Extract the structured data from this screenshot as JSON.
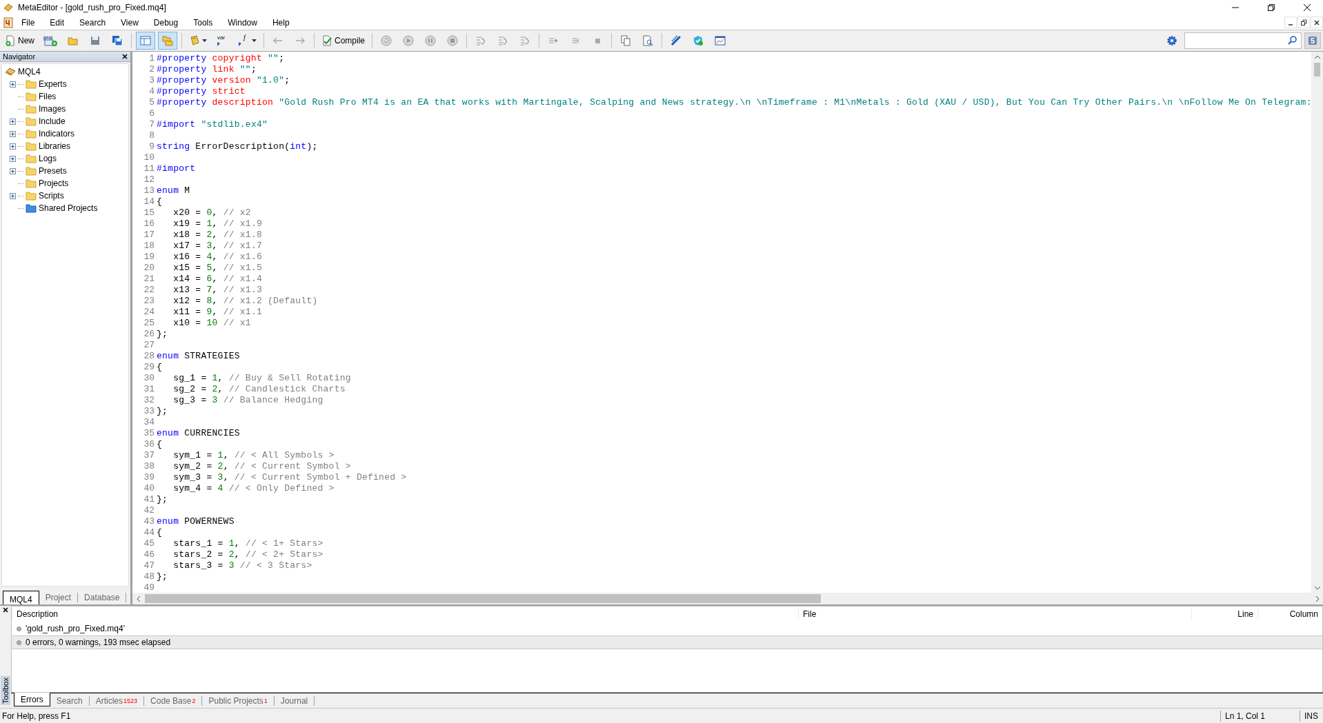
{
  "window": {
    "title": "MetaEditor - [gold_rush_pro_Fixed.mq4]"
  },
  "menu": [
    "File",
    "Edit",
    "Search",
    "View",
    "Debug",
    "Tools",
    "Window",
    "Help"
  ],
  "toolbar": {
    "new_label": "New",
    "project_icon_text": "proj",
    "var_icon_text": "var",
    "function_icon_text": "f",
    "compile_label": "Compile",
    "toggles": [
      {
        "selected": true
      },
      {
        "selected": true
      }
    ],
    "history_disabled": true,
    "debug_disabled": true,
    "messages_count": "5"
  },
  "navigator": {
    "title": "Navigator",
    "root": "MQL4",
    "items": [
      {
        "label": "Experts",
        "kind": "folder",
        "expandable": true
      },
      {
        "label": "Files",
        "kind": "folder",
        "expandable": false
      },
      {
        "label": "Images",
        "kind": "folder",
        "expandable": false
      },
      {
        "label": "Include",
        "kind": "folder",
        "expandable": true
      },
      {
        "label": "Indicators",
        "kind": "folder",
        "expandable": true
      },
      {
        "label": "Libraries",
        "kind": "folder",
        "expandable": true
      },
      {
        "label": "Logs",
        "kind": "folder",
        "expandable": true
      },
      {
        "label": "Presets",
        "kind": "folder",
        "expandable": true
      },
      {
        "label": "Projects",
        "kind": "folder",
        "expandable": false
      },
      {
        "label": "Scripts",
        "kind": "folder",
        "expandable": true
      },
      {
        "label": "Shared Projects",
        "kind": "shared",
        "expandable": false
      }
    ],
    "tabs": [
      {
        "label": "MQL4",
        "selected": true
      },
      {
        "label": "Project",
        "selected": false
      },
      {
        "label": "Database",
        "selected": false
      }
    ]
  },
  "editor": {
    "lines": [
      {
        "n": "1",
        "code": [
          {
            "kind": "directive",
            "text": "#property "
          },
          {
            "kind": "property",
            "text": "copyright "
          },
          {
            "kind": "string",
            "text": "\"\""
          },
          {
            "kind": "plain",
            "text": ";"
          }
        ]
      },
      {
        "n": "2",
        "code": [
          {
            "kind": "directive",
            "text": "#property "
          },
          {
            "kind": "property",
            "text": "link "
          },
          {
            "kind": "string",
            "text": "\"\""
          },
          {
            "kind": "plain",
            "text": ";"
          }
        ]
      },
      {
        "n": "3",
        "code": [
          {
            "kind": "directive",
            "text": "#property "
          },
          {
            "kind": "property",
            "text": "version "
          },
          {
            "kind": "string",
            "text": "\"1.0\""
          },
          {
            "kind": "plain",
            "text": ";"
          }
        ]
      },
      {
        "n": "4",
        "code": [
          {
            "kind": "directive",
            "text": "#property "
          },
          {
            "kind": "property",
            "text": "strict"
          }
        ]
      },
      {
        "n": "5",
        "code": [
          {
            "kind": "directive",
            "text": "#property "
          },
          {
            "kind": "property",
            "text": "description "
          },
          {
            "kind": "string",
            "text": "\"Gold Rush Pro MT4 is an EA that works with Martingale, Scalping and News strategy.\\n \\nTimeframe : M1\\nMetals : Gold (XAU / USD), But You Can Try Other Pairs.\\n \\nFollow Me On Telegram:"
          }
        ]
      },
      {
        "n": "6"
      },
      {
        "n": "7",
        "code": [
          {
            "kind": "directive",
            "text": "#import "
          },
          {
            "kind": "string",
            "text": "\"stdlib.ex4\""
          }
        ]
      },
      {
        "n": "8"
      },
      {
        "n": "9",
        "code": [
          {
            "kind": "keyword",
            "text": "string "
          },
          {
            "kind": "plain",
            "text": "ErrorDescription("
          },
          {
            "kind": "keyword",
            "text": "int"
          },
          {
            "kind": "plain",
            "text": ");"
          }
        ]
      },
      {
        "n": "10"
      },
      {
        "n": "11",
        "code": [
          {
            "kind": "directive",
            "text": "#import"
          }
        ]
      },
      {
        "n": "12"
      },
      {
        "n": "13",
        "code": [
          {
            "kind": "keyword",
            "text": "enum "
          },
          {
            "kind": "plain",
            "text": "M"
          }
        ]
      },
      {
        "n": "14",
        "code": [
          {
            "kind": "plain",
            "text": "{"
          }
        ]
      },
      {
        "n": "15",
        "code": [
          {
            "kind": "plain",
            "text": "   x20 = "
          },
          {
            "kind": "number",
            "text": "0"
          },
          {
            "kind": "plain",
            "text": ", "
          },
          {
            "kind": "comment",
            "text": "// x2"
          }
        ]
      },
      {
        "n": "16",
        "code": [
          {
            "kind": "plain",
            "text": "   x19 = "
          },
          {
            "kind": "number",
            "text": "1"
          },
          {
            "kind": "plain",
            "text": ", "
          },
          {
            "kind": "comment",
            "text": "// x1.9"
          }
        ]
      },
      {
        "n": "17",
        "code": [
          {
            "kind": "plain",
            "text": "   x18 = "
          },
          {
            "kind": "number",
            "text": "2"
          },
          {
            "kind": "plain",
            "text": ", "
          },
          {
            "kind": "comment",
            "text": "// x1.8"
          }
        ]
      },
      {
        "n": "18",
        "code": [
          {
            "kind": "plain",
            "text": "   x17 = "
          },
          {
            "kind": "number",
            "text": "3"
          },
          {
            "kind": "plain",
            "text": ", "
          },
          {
            "kind": "comment",
            "text": "// x1.7"
          }
        ]
      },
      {
        "n": "19",
        "code": [
          {
            "kind": "plain",
            "text": "   x16 = "
          },
          {
            "kind": "number",
            "text": "4"
          },
          {
            "kind": "plain",
            "text": ", "
          },
          {
            "kind": "comment",
            "text": "// x1.6"
          }
        ]
      },
      {
        "n": "20",
        "code": [
          {
            "kind": "plain",
            "text": "   x15 = "
          },
          {
            "kind": "number",
            "text": "5"
          },
          {
            "kind": "plain",
            "text": ", "
          },
          {
            "kind": "comment",
            "text": "// x1.5"
          }
        ]
      },
      {
        "n": "21",
        "code": [
          {
            "kind": "plain",
            "text": "   x14 = "
          },
          {
            "kind": "number",
            "text": "6"
          },
          {
            "kind": "plain",
            "text": ", "
          },
          {
            "kind": "comment",
            "text": "// x1.4"
          }
        ]
      },
      {
        "n": "22",
        "code": [
          {
            "kind": "plain",
            "text": "   x13 = "
          },
          {
            "kind": "number",
            "text": "7"
          },
          {
            "kind": "plain",
            "text": ", "
          },
          {
            "kind": "comment",
            "text": "// x1.3"
          }
        ]
      },
      {
        "n": "23",
        "code": [
          {
            "kind": "plain",
            "text": "   x12 = "
          },
          {
            "kind": "number",
            "text": "8"
          },
          {
            "kind": "plain",
            "text": ", "
          },
          {
            "kind": "comment",
            "text": "// x1.2 (Default)"
          }
        ]
      },
      {
        "n": "24",
        "code": [
          {
            "kind": "plain",
            "text": "   x11 = "
          },
          {
            "kind": "number",
            "text": "9"
          },
          {
            "kind": "plain",
            "text": ", "
          },
          {
            "kind": "comment",
            "text": "// x1.1"
          }
        ]
      },
      {
        "n": "25",
        "code": [
          {
            "kind": "plain",
            "text": "   x10 = "
          },
          {
            "kind": "number",
            "text": "10"
          },
          {
            "kind": "comment",
            "text": " // x1"
          }
        ]
      },
      {
        "n": "26",
        "code": [
          {
            "kind": "plain",
            "text": "};"
          }
        ]
      },
      {
        "n": "27"
      },
      {
        "n": "28",
        "code": [
          {
            "kind": "keyword",
            "text": "enum "
          },
          {
            "kind": "plain",
            "text": "STRATEGIES"
          }
        ]
      },
      {
        "n": "29",
        "code": [
          {
            "kind": "plain",
            "text": "{"
          }
        ]
      },
      {
        "n": "30",
        "code": [
          {
            "kind": "plain",
            "text": "   sg_1 = "
          },
          {
            "kind": "number",
            "text": "1"
          },
          {
            "kind": "plain",
            "text": ", "
          },
          {
            "kind": "comment",
            "text": "// Buy & Sell Rotating"
          }
        ]
      },
      {
        "n": "31",
        "code": [
          {
            "kind": "plain",
            "text": "   sg_2 = "
          },
          {
            "kind": "number",
            "text": "2"
          },
          {
            "kind": "plain",
            "text": ", "
          },
          {
            "kind": "comment",
            "text": "// Candlestick Charts"
          }
        ]
      },
      {
        "n": "32",
        "code": [
          {
            "kind": "plain",
            "text": "   sg_3 = "
          },
          {
            "kind": "number",
            "text": "3"
          },
          {
            "kind": "comment",
            "text": " // Balance Hedging"
          }
        ]
      },
      {
        "n": "33",
        "code": [
          {
            "kind": "plain",
            "text": "};"
          }
        ]
      },
      {
        "n": "34"
      },
      {
        "n": "35",
        "code": [
          {
            "kind": "keyword",
            "text": "enum "
          },
          {
            "kind": "plain",
            "text": "CURRENCIES"
          }
        ]
      },
      {
        "n": "36",
        "code": [
          {
            "kind": "plain",
            "text": "{"
          }
        ]
      },
      {
        "n": "37",
        "code": [
          {
            "kind": "plain",
            "text": "   sym_1 = "
          },
          {
            "kind": "number",
            "text": "1"
          },
          {
            "kind": "plain",
            "text": ", "
          },
          {
            "kind": "comment",
            "text": "// < All Symbols >"
          }
        ]
      },
      {
        "n": "38",
        "code": [
          {
            "kind": "plain",
            "text": "   sym_2 = "
          },
          {
            "kind": "number",
            "text": "2"
          },
          {
            "kind": "plain",
            "text": ", "
          },
          {
            "kind": "comment",
            "text": "// < Current Symbol >"
          }
        ]
      },
      {
        "n": "39",
        "code": [
          {
            "kind": "plain",
            "text": "   sym_3 = "
          },
          {
            "kind": "number",
            "text": "3"
          },
          {
            "kind": "plain",
            "text": ", "
          },
          {
            "kind": "comment",
            "text": "// < Current Symbol + Defined >"
          }
        ]
      },
      {
        "n": "40",
        "code": [
          {
            "kind": "plain",
            "text": "   sym_4 = "
          },
          {
            "kind": "number",
            "text": "4"
          },
          {
            "kind": "comment",
            "text": " // < Only Defined >"
          }
        ]
      },
      {
        "n": "41",
        "code": [
          {
            "kind": "plain",
            "text": "};"
          }
        ]
      },
      {
        "n": "42"
      },
      {
        "n": "43",
        "code": [
          {
            "kind": "keyword",
            "text": "enum "
          },
          {
            "kind": "plain",
            "text": "POWERNEWS"
          }
        ]
      },
      {
        "n": "44",
        "code": [
          {
            "kind": "plain",
            "text": "{"
          }
        ]
      },
      {
        "n": "45",
        "code": [
          {
            "kind": "plain",
            "text": "   stars_1 = "
          },
          {
            "kind": "number",
            "text": "1"
          },
          {
            "kind": "plain",
            "text": ", "
          },
          {
            "kind": "comment",
            "text": "// < 1+ Stars>"
          }
        ]
      },
      {
        "n": "46",
        "code": [
          {
            "kind": "plain",
            "text": "   stars_2 = "
          },
          {
            "kind": "number",
            "text": "2"
          },
          {
            "kind": "plain",
            "text": ", "
          },
          {
            "kind": "comment",
            "text": "// < 2+ Stars>"
          }
        ]
      },
      {
        "n": "47",
        "code": [
          {
            "kind": "plain",
            "text": "   stars_3 = "
          },
          {
            "kind": "number",
            "text": "3"
          },
          {
            "kind": "comment",
            "text": " // < 3 Stars>"
          }
        ]
      },
      {
        "n": "48",
        "code": [
          {
            "kind": "plain",
            "text": "};"
          }
        ]
      },
      {
        "n": "49"
      }
    ]
  },
  "toolbox": {
    "label": "Toolbox",
    "columns": [
      "Description",
      "File",
      "Line",
      "Column"
    ],
    "rows": [
      {
        "description": "'gold_rush_pro_Fixed.mq4'",
        "selected": false
      },
      {
        "description": "0 errors, 0 warnings, 193 msec elapsed",
        "selected": true
      }
    ],
    "tabs": [
      {
        "label": "Errors",
        "selected": true
      },
      {
        "label": "Search",
        "selected": false
      },
      {
        "label": "Articles",
        "count": "1523",
        "selected": false
      },
      {
        "label": "Code Base",
        "count": "2",
        "selected": false
      },
      {
        "label": "Public Projects",
        "count": "1",
        "selected": false
      },
      {
        "label": "Journal",
        "selected": false
      }
    ]
  },
  "status_bar": {
    "help": "For Help, press F1",
    "position": "Ln 1, Col 1",
    "mode": "INS"
  }
}
